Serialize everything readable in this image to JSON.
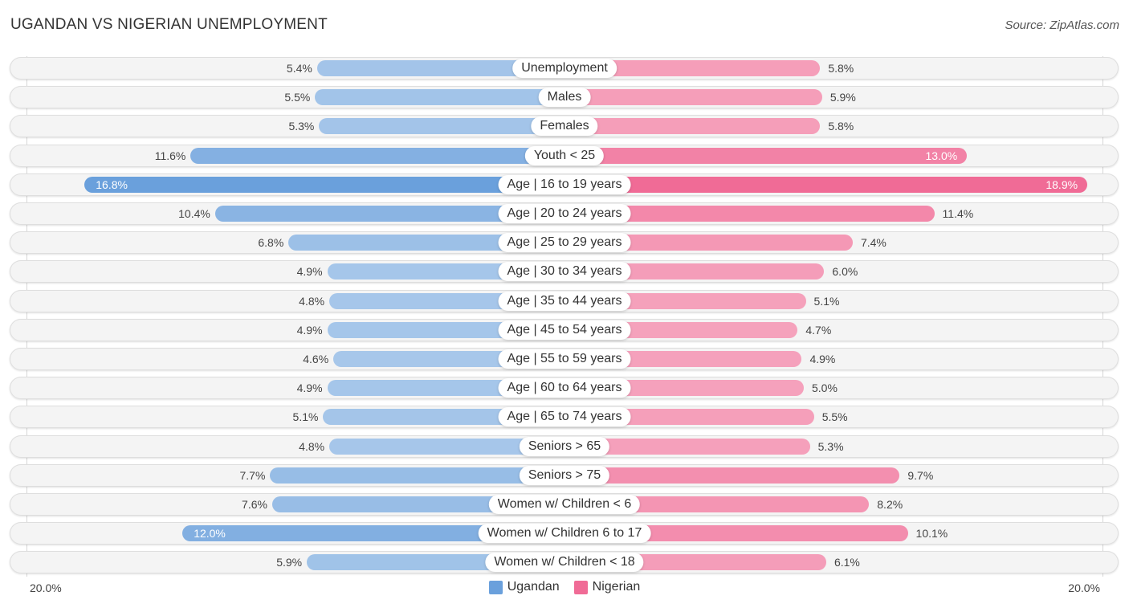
{
  "header": {
    "title": "UGANDAN VS NIGERIAN UNEMPLOYMENT",
    "source": "Source: ZipAtlas.com"
  },
  "colors": {
    "ugandan_light": "#a7c7ea",
    "ugandan_dark": "#6aa0dc",
    "nigerian_light": "#f5a3bd",
    "nigerian_dark": "#f06b96"
  },
  "chart_data": {
    "type": "bar",
    "orientation": "diverging-horizontal",
    "title": "UGANDAN VS NIGERIAN UNEMPLOYMENT",
    "source": "Source: ZipAtlas.com",
    "categories": [
      "Unemployment",
      "Males",
      "Females",
      "Youth < 25",
      "Age | 16 to 19 years",
      "Age | 20 to 24 years",
      "Age | 25 to 29 years",
      "Age | 30 to 34 years",
      "Age | 35 to 44 years",
      "Age | 45 to 54 years",
      "Age | 55 to 59 years",
      "Age | 60 to 64 years",
      "Age | 65 to 74 years",
      "Seniors > 65",
      "Seniors > 75",
      "Women w/ Children < 6",
      "Women w/ Children 6 to 17",
      "Women w/ Children < 18"
    ],
    "series": [
      {
        "name": "Ugandan",
        "side": "left",
        "values": [
          5.4,
          5.5,
          5.3,
          11.6,
          16.8,
          10.4,
          6.8,
          4.9,
          4.8,
          4.9,
          4.6,
          4.9,
          5.1,
          4.8,
          7.7,
          7.6,
          12.0,
          5.9
        ],
        "labels": [
          "5.4%",
          "5.5%",
          "5.3%",
          "11.6%",
          "16.8%",
          "10.4%",
          "6.8%",
          "4.9%",
          "4.8%",
          "4.9%",
          "4.6%",
          "4.9%",
          "5.1%",
          "4.8%",
          "7.7%",
          "7.6%",
          "12.0%",
          "5.9%"
        ]
      },
      {
        "name": "Nigerian",
        "side": "right",
        "values": [
          5.8,
          5.9,
          5.8,
          13.0,
          18.9,
          11.4,
          7.4,
          6.0,
          5.1,
          4.7,
          4.9,
          5.0,
          5.5,
          5.3,
          9.7,
          8.2,
          10.1,
          6.1
        ],
        "labels": [
          "5.8%",
          "5.9%",
          "5.8%",
          "13.0%",
          "18.9%",
          "11.4%",
          "7.4%",
          "6.0%",
          "5.1%",
          "4.7%",
          "4.9%",
          "5.0%",
          "5.5%",
          "5.3%",
          "9.7%",
          "8.2%",
          "10.1%",
          "6.1%"
        ]
      }
    ],
    "axis": {
      "min_label": "20.0%",
      "max_label": "20.0%",
      "range": [
        0,
        20
      ]
    },
    "legend": {
      "position": "bottom-center",
      "entries": [
        "Ugandan",
        "Nigerian"
      ]
    },
    "grid": false
  }
}
